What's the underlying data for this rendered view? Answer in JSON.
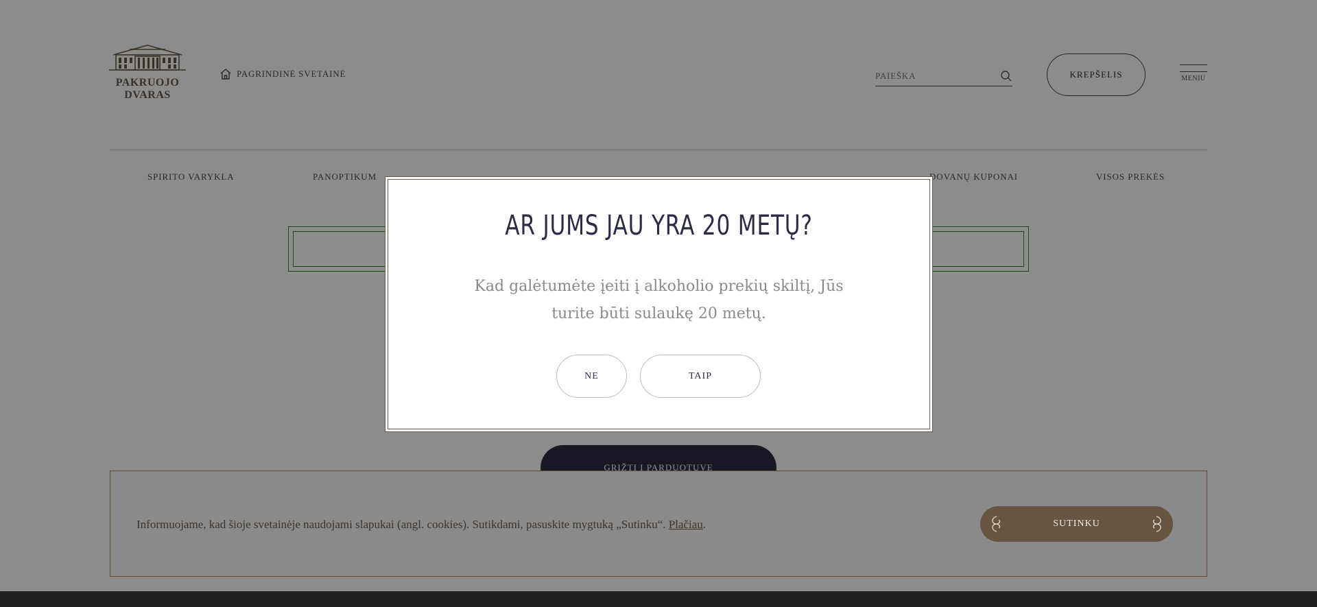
{
  "header": {
    "logo_text_line1": "PAKRUOJO",
    "logo_text_line2": "DVARAS",
    "main_site_link": "PAGRINDINĖ SVETAINĖ",
    "search_placeholder": "PAIEŠKA",
    "cart_label": "KREPŠELIS",
    "menu_label": "MENIU"
  },
  "nav": {
    "items": [
      {
        "label": "SPIRITO VARYKLA"
      },
      {
        "label": "PANOPTIKUM"
      },
      {
        "label": "DOVANŲ KUPONAI"
      },
      {
        "label": "VISOS PREKĖS"
      }
    ]
  },
  "main": {
    "back_button": "GRĮŽTI Į PARDUOTUVĘ"
  },
  "age_modal": {
    "title": "AR JUMS JAU YRA 20 METŲ?",
    "text": "Kad galėtumėte įeiti į alkoholio prekių skiltį, Jūs turite būti sulaukę 20 metų.",
    "no_label": "NE",
    "yes_label": "TAIP"
  },
  "cookie_banner": {
    "text": "Informuojame, kad šioje svetainėje naudojami slapukai (angl. cookies). Sutikdami, pasuskite mygtuką „Sutinku“.",
    "more_link": "Plačiau",
    "trailing": ".",
    "agree_label": "SUTINKU"
  },
  "colors": {
    "brand_brown": "#675441",
    "navy": "#2d2d44",
    "accent_green": "#3f7a3f"
  },
  "icons": [
    "logo-manor-icon",
    "home-icon",
    "search-icon",
    "hamburger-menu-icon",
    "ornament-icon"
  ]
}
